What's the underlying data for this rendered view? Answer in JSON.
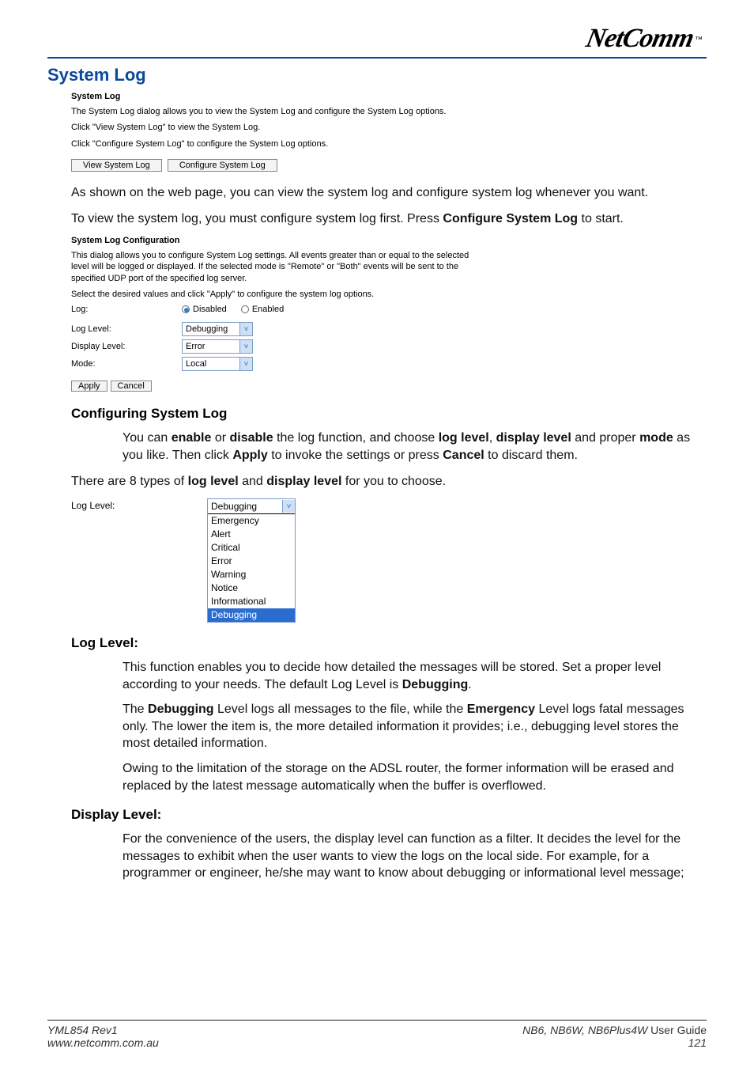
{
  "brand": {
    "name": "NetComm",
    "tm": "™"
  },
  "h1": "System Log",
  "ss1": {
    "title": "System Log",
    "p1": "The System Log dialog allows you to view the System Log and configure the System Log options.",
    "p2": "Click \"View System Log\" to view the System Log.",
    "p3": "Click \"Configure System Log\" to configure the System Log options.",
    "btn_view": "View System Log",
    "btn_conf": "Configure System Log"
  },
  "body1": "As shown on the web page, you can view the system log and configure system log whenever you want.",
  "body2_a": "To view the system log, you must configure system log first. Press ",
  "body2_b": "Configure System Log",
  "body2_c": " to start.",
  "ss2": {
    "title": "System Log Configuration",
    "p1": "This dialog allows you to configure System Log settings. All events greater than or equal to the selected level will be logged or displayed. If the selected mode is \"Remote\" or \"Both\" events will be sent to the specified UDP port of the specified log server.",
    "p2": "Select the desired values and click \"Apply\" to configure the system log options.",
    "log_label": "Log:",
    "log_disabled": "Disabled",
    "log_enabled": "Enabled",
    "loglevel_label": "Log Level:",
    "loglevel_val": "Debugging",
    "displevel_label": "Display Level:",
    "displevel_val": "Error",
    "mode_label": "Mode:",
    "mode_val": "Local",
    "btn_apply": "Apply",
    "btn_cancel": "Cancel"
  },
  "h2": "Configuring System Log",
  "cfg_a": "You can ",
  "cfg_b": "enable",
  "cfg_c": " or ",
  "cfg_d": "disable",
  "cfg_e": " the log function, and choose ",
  "cfg_f": "log level",
  "cfg_g": ", ",
  "cfg_h": "display level",
  "cfg_i": " and proper ",
  "cfg_j": "mode",
  "cfg_k": " as you like. Then click ",
  "cfg_l": "Apply",
  "cfg_m": " to invoke the settings or press ",
  "cfg_n": "Cancel",
  "cfg_o": " to discard them.",
  "body3_a": "There are 8 types of ",
  "body3_b": "log level",
  "body3_c": " and ",
  "body3_d": "display level",
  "body3_e": " for you to choose.",
  "ll_dropdown": {
    "label": "Log Level:",
    "selected": "Debugging",
    "items": [
      "Emergency",
      "Alert",
      "Critical",
      "Error",
      "Warning",
      "Notice",
      "Informational",
      "Debugging"
    ]
  },
  "h3": "Log Level:",
  "ll_p1_a": "This function enables you to decide how detailed the messages will be stored. Set a proper level according to your needs. The default Log Level is ",
  "ll_p1_b": "Debugging",
  "ll_p1_c": ".",
  "ll_p2_a": "The ",
  "ll_p2_b": "Debugging",
  "ll_p2_c": " Level logs all messages to the file, while the ",
  "ll_p2_d": "Emergency",
  "ll_p2_e": " Level logs fatal messages only. The lower the item is, the more detailed information it provides; i.e., debugging level stores the most detailed information.",
  "ll_p3": "Owing to the limitation of the storage on the ADSL router, the former information will be erased and replaced by the latest message automatically when the buffer is overflowed.",
  "h4": "Display Level:",
  "dl_p1": "For the convenience of the users, the display level can function as a filter. It decides the level for the messages to exhibit when the user wants to view the logs on the local side. For example, for a programmer or engineer, he/she may want to know about debugging or informational level message;",
  "footer": {
    "rev": "YML854 Rev1",
    "url": "www.netcomm.com.au",
    "models": "NB6, NB6W, NB6Plus4W",
    "guide": " User Guide",
    "page": "121"
  }
}
